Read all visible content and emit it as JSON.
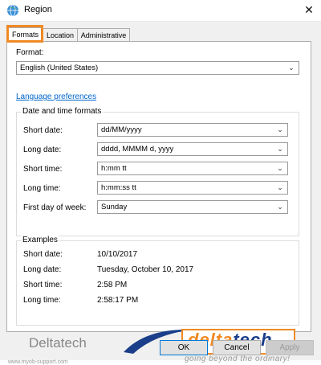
{
  "window": {
    "title": "Region",
    "close_glyph": "✕"
  },
  "tabs": [
    {
      "label": "Formats",
      "active": true
    },
    {
      "label": "Location",
      "active": false
    },
    {
      "label": "Administrative",
      "active": false
    }
  ],
  "format": {
    "label": "Format:",
    "value": "English (United States)"
  },
  "language_link": "Language preferences",
  "datetime": {
    "group_title": "Date and time formats",
    "rows": [
      {
        "label": "Short date:",
        "value": "dd/MM/yyyy"
      },
      {
        "label": "Long date:",
        "value": "dddd, MMMM d, yyyy"
      },
      {
        "label": "Short time:",
        "value": "h:mm tt"
      },
      {
        "label": "Long time:",
        "value": "h:mm:ss tt"
      },
      {
        "label": "First day of week:",
        "value": "Sunday"
      }
    ]
  },
  "examples": {
    "group_title": "Examples",
    "rows": [
      {
        "label": "Short date:",
        "value": "10/10/2017"
      },
      {
        "label": "Long date:",
        "value": "Tuesday, October 10, 2017"
      },
      {
        "label": "Short time:",
        "value": "2:58 PM"
      },
      {
        "label": "Long time:",
        "value": "2:58:17 PM"
      }
    ]
  },
  "branding": {
    "text": "Deltatech",
    "logo_part1": "delta",
    "logo_part2": "tech",
    "tagline": "going beyond the ordinary!",
    "website": "www.myob-support.com",
    "colors": {
      "orange": "#f08a24",
      "navy": "#1a3e8a"
    }
  },
  "buttons": {
    "ok": "OK",
    "cancel": "Cancel",
    "apply": "Apply"
  },
  "icons": {
    "app": "region-globe-icon",
    "dropdown": "chevron-down-icon",
    "close": "close-icon"
  }
}
